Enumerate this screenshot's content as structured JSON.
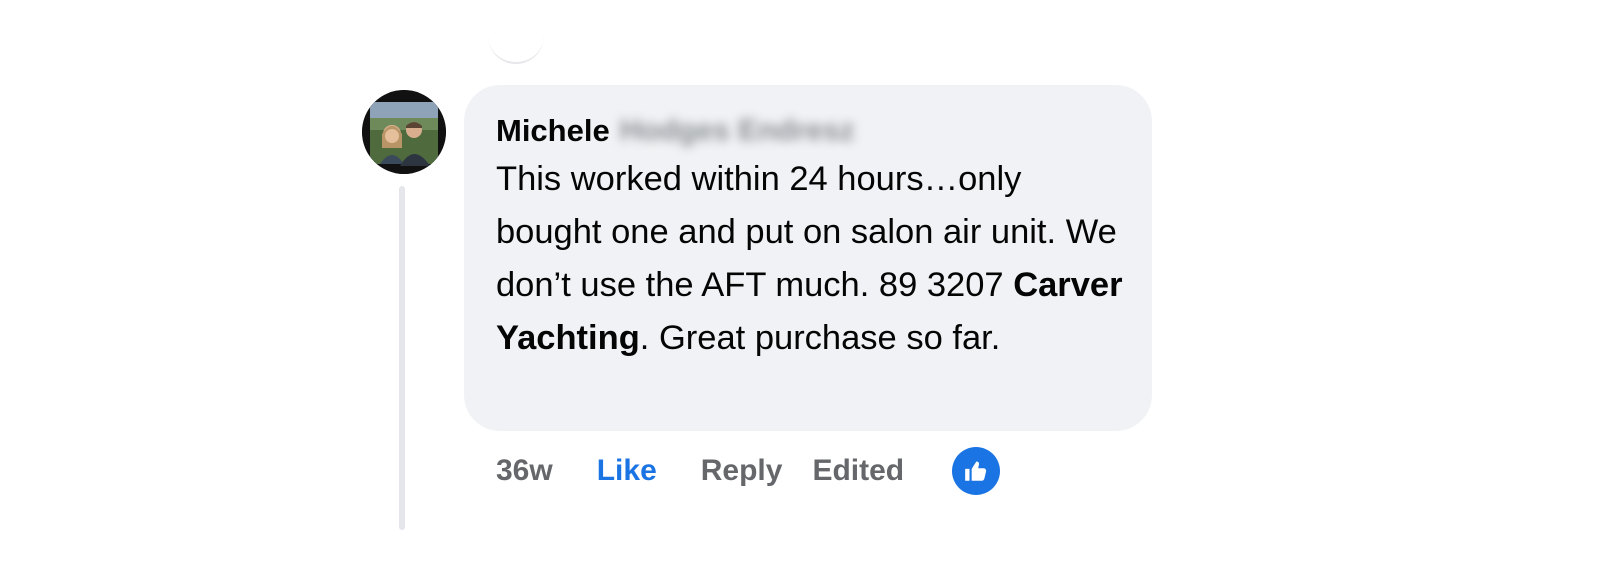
{
  "comment": {
    "author_first": "Michele",
    "author_last_blurred": "Hodges Endresz",
    "text_parts": {
      "p1": "This worked within 24 hours…only bought one and put on salon air unit. We don’t use the AFT much. 89 3207 ",
      "mention": "Carver Yachting",
      "p2": ". Great purchase so far."
    },
    "time": "36w",
    "like_label": "Like",
    "reply_label": "Reply",
    "edited_label": "Edited"
  },
  "colors": {
    "accent": "#1b74e4",
    "bubble": "#f0f2f5",
    "muted_text": "#65676b"
  },
  "icons": {
    "reaction": "thumbs-up-icon"
  }
}
